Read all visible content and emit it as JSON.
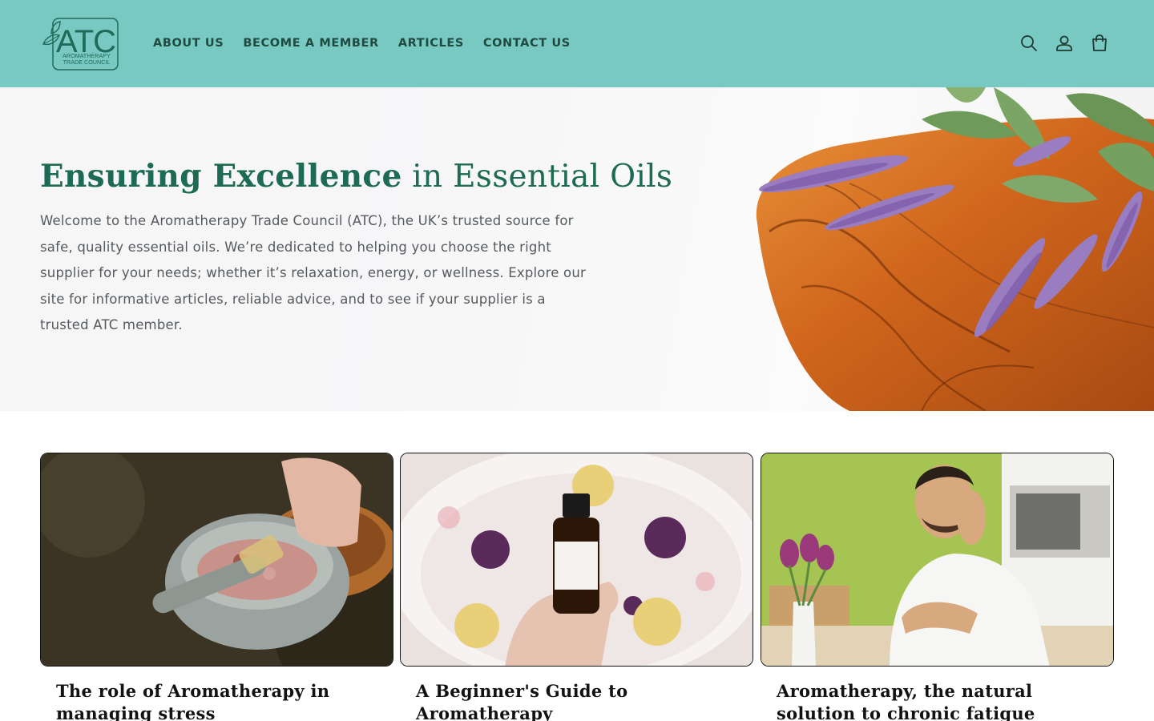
{
  "header": {
    "logo": {
      "text": "ATC",
      "subtitle_line1": "AROMATHERAPY",
      "subtitle_line2": "TRADE COUNCIL",
      "icon": "leaf-icon"
    },
    "nav": [
      {
        "label": "ABOUT US"
      },
      {
        "label": "BECOME A MEMBER"
      },
      {
        "label": "ARTICLES"
      },
      {
        "label": "CONTACT US"
      }
    ],
    "icons": {
      "search": "search-icon",
      "account": "account-icon",
      "cart": "cart-icon"
    }
  },
  "hero": {
    "title_strong": "Ensuring Excellence",
    "title_rest": " in Essential Oils",
    "body": "Welcome to the Aromatherapy Trade Council (ATC), the UK’s trusted source for safe, quality essential oils. We’re dedicated to helping you choose the right supplier for your needs; whether it’s relaxation, energy, or wellness. Explore our site for informative articles, reliable advice, and to see if your supplier is a trusted ATC member."
  },
  "articles": [
    {
      "title": "The role of Aromatherapy in managing stress"
    },
    {
      "title": "A Beginner's Guide to Aromatherapy"
    },
    {
      "title": "Aromatherapy, the natural solution to chronic fatigue"
    }
  ],
  "colors": {
    "header_bg": "#79c9c3",
    "nav_text": "#1f4a40",
    "hero_title": "#1d6a55",
    "logo": "#1f6b5a"
  }
}
